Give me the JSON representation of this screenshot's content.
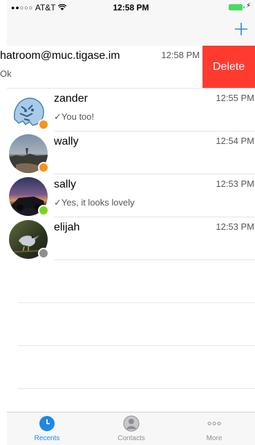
{
  "status": {
    "signal": "●●○○○",
    "carrier": "AT&T",
    "time": "12:58 PM"
  },
  "swiped_row": {
    "name": "hatroom@muc.tigase.im",
    "time": "12:58 PM",
    "preview": "Ok",
    "delete_label": "Delete"
  },
  "rows": [
    {
      "name": "zander",
      "time": "12:55 PM",
      "preview": "✓You too!",
      "presence_color": "#f7931e"
    },
    {
      "name": "wally",
      "time": "12:54 PM",
      "preview": "",
      "presence_color": "#f7931e"
    },
    {
      "name": "sally",
      "time": "12:53 PM",
      "preview": "✓Yes, it looks lovely",
      "presence_color": "#7ed321"
    },
    {
      "name": "elijah",
      "time": "12:53 PM",
      "preview": "",
      "presence_color": "#8e8e93"
    }
  ],
  "tabs": [
    {
      "label": "Recents",
      "icon": "clock-icon",
      "active": true
    },
    {
      "label": "Contacts",
      "icon": "person-icon",
      "active": false
    },
    {
      "label": "More",
      "icon": "more-icon",
      "active": false
    }
  ],
  "colors": {
    "accent": "#1e88e5",
    "delete": "#ff3b30"
  }
}
